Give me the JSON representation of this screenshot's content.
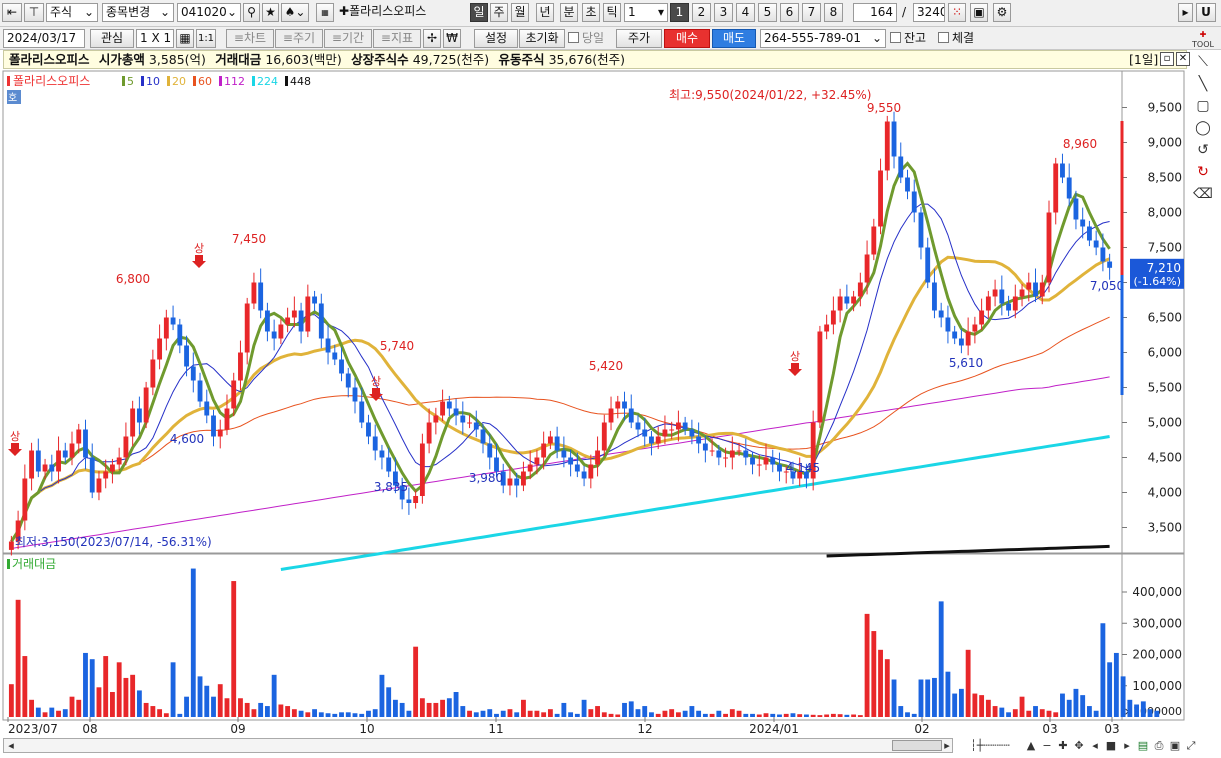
{
  "toolbar1": {
    "market": "주식",
    "menu_change": "종목변경",
    "code": "041020",
    "stock_name": "폴라리스오피스",
    "periods": [
      "일",
      "주",
      "월",
      "년",
      "분",
      "초",
      "틱"
    ],
    "period_active": "일",
    "period_value": "1",
    "numbers": [
      "1",
      "2",
      "3",
      "4",
      "5",
      "6",
      "7",
      "8"
    ],
    "number_active": "1",
    "count": "164",
    "total": "3240",
    "right_btn": "U"
  },
  "toolbar2": {
    "date": "2024/03/17",
    "interest": "관심",
    "layout": "1 X 1",
    "one_one": "1:1",
    "tabs": [
      "≡차트",
      "≡주기",
      "≡기간",
      "≡지표"
    ],
    "won": "₩",
    "settings": "설정",
    "reset": "초기화",
    "today": "당일",
    "price": "주가",
    "buy": "매수",
    "sell": "매도",
    "account": "264-555-789-01",
    "balance": "잔고",
    "fill": "체결"
  },
  "infobar": {
    "name": "폴라리스오피스",
    "mcap_label": "시가총액",
    "mcap_value": "3,585(억)",
    "amount_label": "거래대금",
    "amount_value": "16,603(백만)",
    "listed_label": "상장주식수",
    "listed_value": "49,725(천주)",
    "float_label": "유동주식",
    "float_value": "35,676(천주)",
    "window_tag": "[1일]"
  },
  "legend": {
    "name": "폴라리스오피스",
    "mas": [
      {
        "label": "5",
        "color": "#6f9a2e"
      },
      {
        "label": "10",
        "color": "#2630c8"
      },
      {
        "label": "20",
        "color": "#e0b33a"
      },
      {
        "label": "60",
        "color": "#e8531f"
      },
      {
        "label": "112",
        "color": "#c020c8"
      },
      {
        "label": "224",
        "color": "#1ad6e6"
      },
      {
        "label": "448",
        "color": "#111111"
      }
    ],
    "ho": "호"
  },
  "chart_data": [
    {
      "type": "candlestick",
      "title": "폴라리스오피스",
      "x_ticks": [
        "2023/07",
        "08",
        "09",
        "10",
        "11",
        "12",
        "2024/01",
        "02",
        "03",
        "03"
      ],
      "y_ticks": [
        "9,500",
        "9,000",
        "8,500",
        "8,000",
        "7,500",
        "7,000",
        "6,500",
        "6,000",
        "5,500",
        "5,000",
        "4,500",
        "4,000",
        "3,500"
      ],
      "ylim": [
        3150,
        9650
      ],
      "current_price": "7,210",
      "current_change": "(-1.64%)",
      "annotations": {
        "high": "최고:9,550(2024/01/22, +32.45%)",
        "low": "최저:3,150(2023/07/14, -56.31%)",
        "peak_labels": [
          "6,800",
          "7,450",
          "5,740",
          "5,420",
          "9,550",
          "8,960"
        ],
        "trough_labels": [
          "4,600",
          "3,835",
          "3,980",
          "4,145",
          "5,610",
          "7,050"
        ],
        "up_limit_marker": "상"
      },
      "closes": [
        3300,
        3600,
        4200,
        4600,
        4300,
        4400,
        4300,
        4600,
        4500,
        4700,
        4900,
        4500,
        4000,
        4200,
        4300,
        4400,
        4500,
        4800,
        5200,
        5000,
        5500,
        5900,
        6200,
        6500,
        6400,
        6100,
        5800,
        5600,
        5300,
        5100,
        4800,
        4900,
        5200,
        5600,
        6000,
        6700,
        7000,
        6600,
        6300,
        6200,
        6400,
        6500,
        6600,
        6300,
        6800,
        6700,
        6200,
        6000,
        5900,
        5700,
        5500,
        5300,
        5000,
        4800,
        4600,
        4500,
        4300,
        4100,
        3900,
        3850,
        3950,
        4700,
        5000,
        5100,
        5300,
        5200,
        5100,
        5000,
        5000,
        4900,
        4700,
        4500,
        4300,
        4100,
        4200,
        4100,
        4300,
        4400,
        4500,
        4700,
        4800,
        4600,
        4500,
        4400,
        4300,
        4200,
        4400,
        4600,
        5000,
        5200,
        5300,
        5200,
        5000,
        4900,
        4800,
        4700,
        4800,
        4900,
        4900,
        5000,
        4900,
        4800,
        4700,
        4600,
        4600,
        4500,
        4500,
        4600,
        4600,
        4500,
        4400,
        4400,
        4500,
        4400,
        4300,
        4300,
        4200,
        4300,
        4200,
        5000,
        6300,
        6400,
        6600,
        6800,
        6700,
        6800,
        7000,
        7400,
        7800,
        8600,
        9300,
        8800,
        8500,
        8300,
        8000,
        7500,
        7000,
        6600,
        6500,
        6300,
        6200,
        6100,
        6300,
        6400,
        6600,
        6800,
        6900,
        6700,
        6600,
        6800,
        6900,
        7000,
        6800,
        7000,
        8000,
        8700,
        8500,
        8200,
        7900,
        7800,
        7600,
        7500,
        7300,
        7210
      ],
      "ma_periods": [
        5,
        10,
        20,
        60,
        112,
        224,
        448
      ]
    },
    {
      "type": "bar",
      "title": "거래대금",
      "y_ticks": [
        "400,000",
        "300,000",
        "200,000",
        "100,000"
      ],
      "unit": "×1000000",
      "ylim": [
        0,
        480000
      ],
      "values": [
        105000,
        375000,
        195000,
        55000,
        30000,
        15000,
        30000,
        20000,
        25000,
        65000,
        55000,
        205000,
        185000,
        95000,
        195000,
        80000,
        175000,
        125000,
        135000,
        85000,
        45000,
        35000,
        25000,
        12000,
        175000,
        10000,
        65000,
        475000,
        130000,
        100000,
        65000,
        105000,
        60000,
        435000,
        60000,
        45000,
        25000,
        45000,
        35000,
        135000,
        40000,
        35000,
        25000,
        20000,
        15000,
        25000,
        15000,
        12000,
        10000,
        15000,
        15000,
        12000,
        10000,
        20000,
        25000,
        135000,
        95000,
        55000,
        45000,
        20000,
        225000,
        60000,
        45000,
        45000,
        55000,
        60000,
        80000,
        35000,
        20000,
        15000,
        20000,
        25000,
        10000,
        20000,
        25000,
        15000,
        55000,
        20000,
        20000,
        15000,
        25000,
        10000,
        45000,
        15000,
        10000,
        55000,
        25000,
        35000,
        15000,
        10000,
        8000,
        45000,
        50000,
        25000,
        35000,
        15000,
        10000,
        20000,
        25000,
        15000,
        20000,
        35000,
        20000,
        10000,
        10000,
        20000,
        10000,
        25000,
        20000,
        10000,
        10000,
        8000,
        12000,
        10000,
        8000,
        10000,
        12000,
        9000,
        8000,
        7000,
        6000,
        8000,
        10000,
        9000,
        7000,
        8000,
        6000,
        330000,
        275000,
        215000,
        185000,
        120000,
        35000,
        15000,
        10000,
        120000,
        120000,
        125000,
        370000,
        145000,
        75000,
        90000,
        215000,
        75000,
        70000,
        55000,
        35000,
        30000,
        15000,
        25000,
        65000,
        20000,
        35000,
        25000,
        20000,
        15000,
        75000,
        55000,
        90000,
        70000,
        35000,
        20000,
        300000,
        175000,
        205000,
        130000,
        55000,
        40000,
        50000,
        25000,
        20000
      ]
    }
  ]
}
